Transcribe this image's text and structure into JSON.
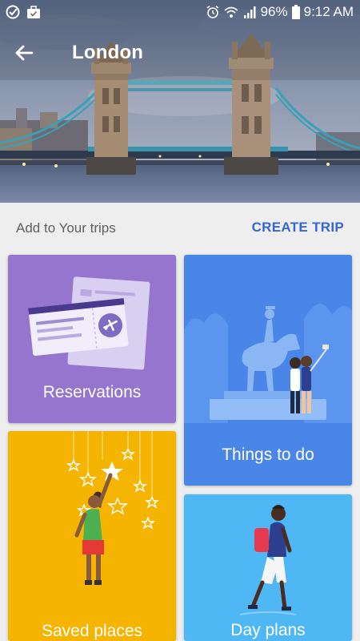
{
  "status_bar": {
    "battery": "96%",
    "time": "9:12 AM"
  },
  "header": {
    "title": "London"
  },
  "trips": {
    "label": "Add to Your trips",
    "create_label": "CREATE TRIP"
  },
  "cards": {
    "reservations": "Reservations",
    "things_to_do": "Things to do",
    "saved_places": "Saved places",
    "day_plans": "Day plans"
  },
  "colors": {
    "accent": "#3367d6",
    "reservations": "#9575cd",
    "things_to_do": "#4a86e8",
    "saved_places": "#f4b400",
    "day_plans": "#4fb8f4"
  }
}
